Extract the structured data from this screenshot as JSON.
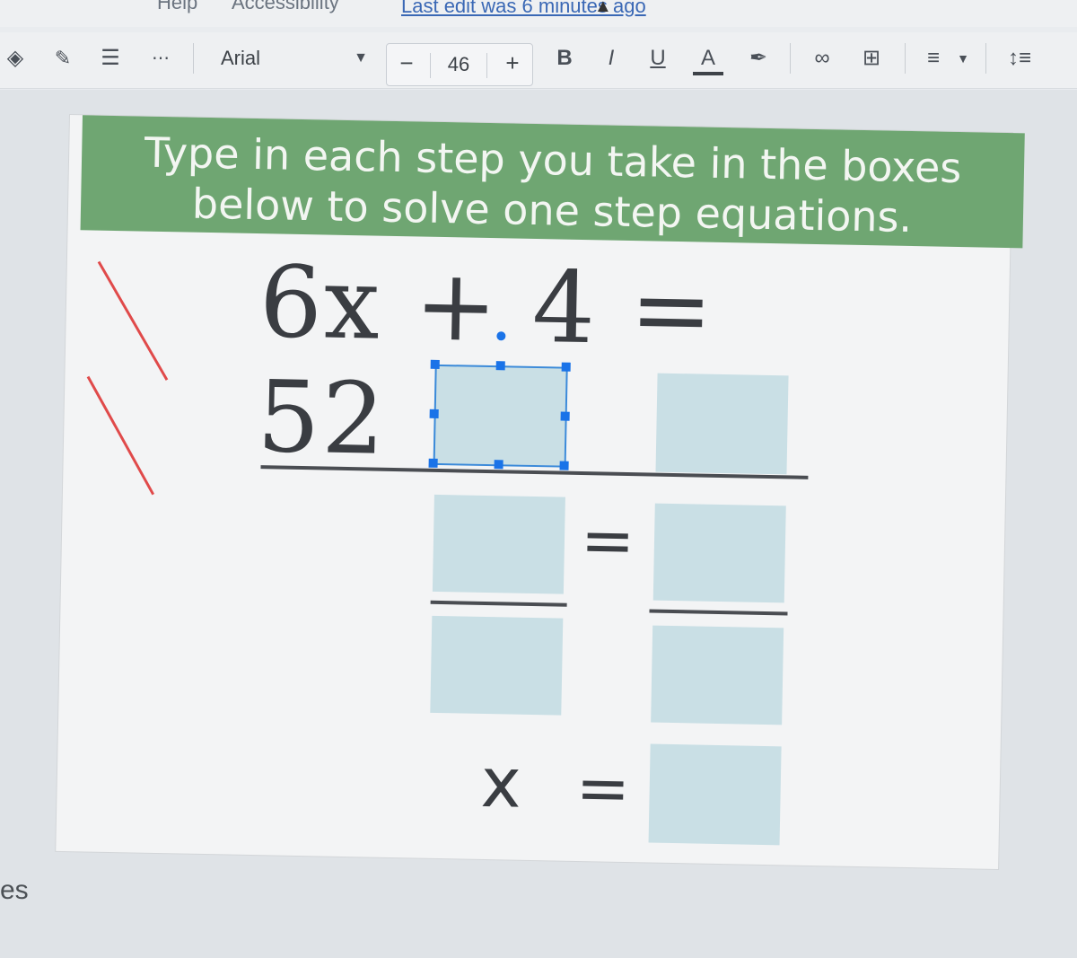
{
  "menubar": {
    "items": [
      "Help",
      "Accessibility"
    ],
    "last_edit": "Last edit was 6 minutes ago"
  },
  "toolbar": {
    "font_name": "Arial",
    "font_size": "46",
    "minus": "−",
    "plus": "+",
    "bold": "B",
    "italic": "I",
    "underline": "U",
    "text_color": "A"
  },
  "slide": {
    "instruction": "Type in each step you take in the boxes below to solve one step equations.",
    "equation": "6x + 4 = 52",
    "equals": "=",
    "x_label": "x"
  },
  "side_label": "es",
  "colors": {
    "banner": "#6fa672",
    "answer_box": "#c9dfe5",
    "selection": "#1a73e8",
    "annotation": "#e04a4a"
  }
}
